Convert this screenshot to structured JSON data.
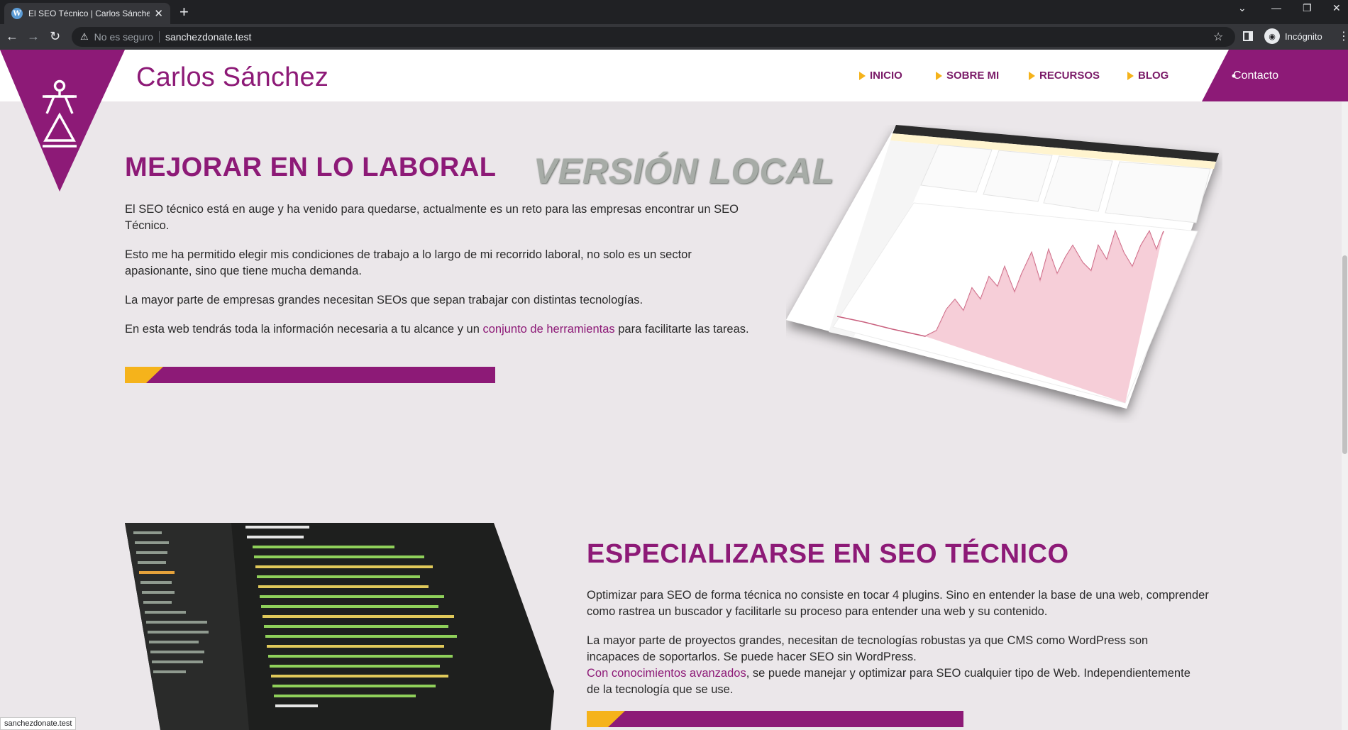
{
  "browser": {
    "tab_title": "El SEO Técnico | Carlos Sánchez",
    "tab_icon": "wordpress-icon",
    "security_label": "No es seguro",
    "url": "sanchezdonate.test",
    "profile_label": "Incógnito",
    "status_url": "sanchezdonate.test"
  },
  "site": {
    "brand": "Carlos Sánchez",
    "nav": [
      {
        "label": "INICIO"
      },
      {
        "label": "SOBRE MI"
      },
      {
        "label": "RECURSOS"
      },
      {
        "label": "BLOG"
      }
    ],
    "contact_label": "Contacto"
  },
  "section1": {
    "title": "MEJORAR EN LO LABORAL",
    "watermark": "VERSIÓN LOCAL",
    "p1": "El SEO técnico está en auge y ha venido para quedarse, actualmente es un reto para las empresas encontrar un SEO Técnico.",
    "p2": "Esto me ha permitido elegir mis condiciones de trabajo a lo largo de mi recorrido laboral, no solo es un sector apasionante, sino que tiene mucha demanda.",
    "p3": "La mayor parte de empresas grandes necesitan SEOs que sepan trabajar con distintas tecnologías.",
    "p4_before": "En esta web tendrás toda la información necesaria a tu alcance y un ",
    "p4_link": "conjunto de herramientas",
    "p4_after": " para facilitarte las tareas."
  },
  "section2": {
    "title": "ESPECIALIZARSE EN SEO TÉCNICO",
    "p1": "Optimizar para SEO de forma técnica no consiste en tocar 4 plugins. Sino en entender la base de una web, comprender como rastrea un buscador y facilitarle su proceso para entender una web y su contenido.",
    "p2": "La mayor parte de proyectos grandes, necesitan de tecnologías robustas ya que CMS como WordPress son incapaces de soportarlos. Se puede hacer SEO sin WordPress.",
    "p3_link": "Con conocimientos avanzados",
    "p3_after": ", se puede manejar y optimizar para SEO cualquier tipo de Web. Independientemente de la tecnología que se use."
  },
  "colors": {
    "brand": "#8d1a77",
    "accent": "#f5b31b",
    "page_bg": "#ebe7ea"
  }
}
